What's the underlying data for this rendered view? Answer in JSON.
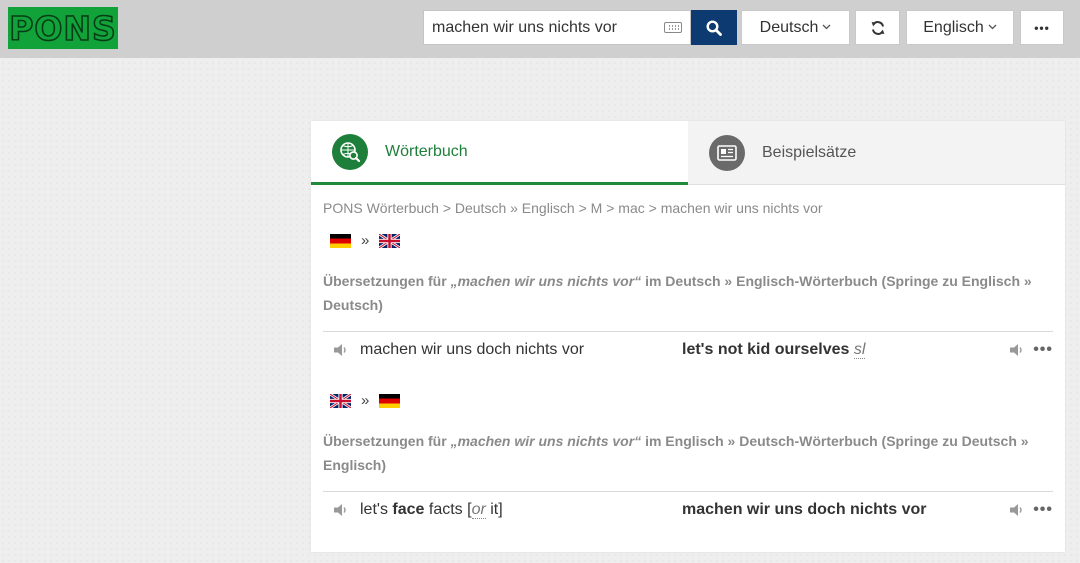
{
  "header": {
    "logo": "PONS",
    "search": {
      "value": "machen wir uns nichts vor",
      "placeholder": ""
    },
    "source_lang": "Deutsch",
    "target_lang": "Englisch",
    "more_label": "•••"
  },
  "tabs": [
    {
      "label": "Wörterbuch",
      "icon": "dictionary-search-icon",
      "active": true
    },
    {
      "label": "Beispielsätze",
      "icon": "example-sentences-icon",
      "active": false
    }
  ],
  "breadcrumb": "PONS Wörterbuch > Deutsch » Englisch > M > mac > machen wir uns nichts vor",
  "sections": [
    {
      "flag_from": "de",
      "flag_to": "uk",
      "arrow": "»",
      "heading_prefix": "Übersetzungen für ",
      "heading_query": "„machen wir uns nichts vor“",
      "heading_suffix": " im Deutsch » Englisch-Wörterbuch (Springe zu Englisch » Deutsch)",
      "entries": [
        {
          "source_parts": [
            {
              "text": "machen wir uns doch nichts vor",
              "bold": false
            }
          ],
          "target": "let's not kid ourselves",
          "target_label": "sl",
          "more": "•••"
        }
      ]
    },
    {
      "flag_from": "uk",
      "flag_to": "de",
      "arrow": "»",
      "heading_prefix": "Übersetzungen für ",
      "heading_query": "„machen wir uns nichts vor“",
      "heading_suffix": " im Englisch » Deutsch-Wörterbuch (Springe zu Deutsch » Englisch)",
      "entries": [
        {
          "source_parts": [
            {
              "text": "let's ",
              "bold": false
            },
            {
              "text": "face",
              "bold": true
            },
            {
              "text": " facts [",
              "bold": false
            },
            {
              "text": "or",
              "abbr": true
            },
            {
              "text": " it]",
              "bold": false
            }
          ],
          "target": "machen wir uns doch nichts vor",
          "target_label": "",
          "more": "•••"
        }
      ]
    }
  ],
  "colors": {
    "brand_green": "#1e7f3a",
    "logo_green": "#12a23a",
    "search_button": "#0d3a70",
    "topbar": "#cfcfcf"
  }
}
